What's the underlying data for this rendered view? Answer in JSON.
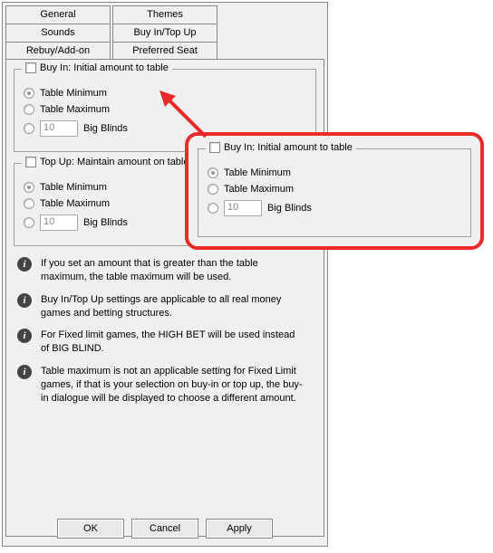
{
  "tabs_row1": [
    "General",
    "Themes",
    "Sounds"
  ],
  "tabs_row2": [
    "Buy In/Top Up",
    "Rebuy/Add-on",
    "Preferred Seat"
  ],
  "active_tab": "Buy In/Top Up",
  "buyin": {
    "title": "Buy In: Initial amount to table",
    "opt1": "Table Minimum",
    "opt2": "Table Maximum",
    "bb_value": "10",
    "bb_label": "Big Blinds"
  },
  "topup": {
    "title": "Top Up: Maintain amount on table",
    "opt1": "Table Minimum",
    "opt2": "Table Maximum",
    "bb_value": "10",
    "bb_label": "Big Blinds"
  },
  "info1": "If you set an amount that is greater than the table maximum, the table maximum will be used.",
  "info2": "Buy In/Top Up settings are applicable to all real money games and betting structures.",
  "info3": "For Fixed limit games, the HIGH BET will be used instead of BIG BLIND.",
  "info4": "Table maximum is not an applicable setting for Fixed Limit games, if that is your selection on buy-in or top up, the buy-in dialogue will be displayed to choose a different amount.",
  "buttons": {
    "ok": "OK",
    "cancel": "Cancel",
    "apply": "Apply"
  },
  "callout": {
    "title": "Buy In: Initial amount to table",
    "opt1": "Table Minimum",
    "opt2": "Table Maximum",
    "bb_value": "10",
    "bb_label": "Big Blinds"
  },
  "colors": {
    "accent": "#ec2a2a"
  }
}
